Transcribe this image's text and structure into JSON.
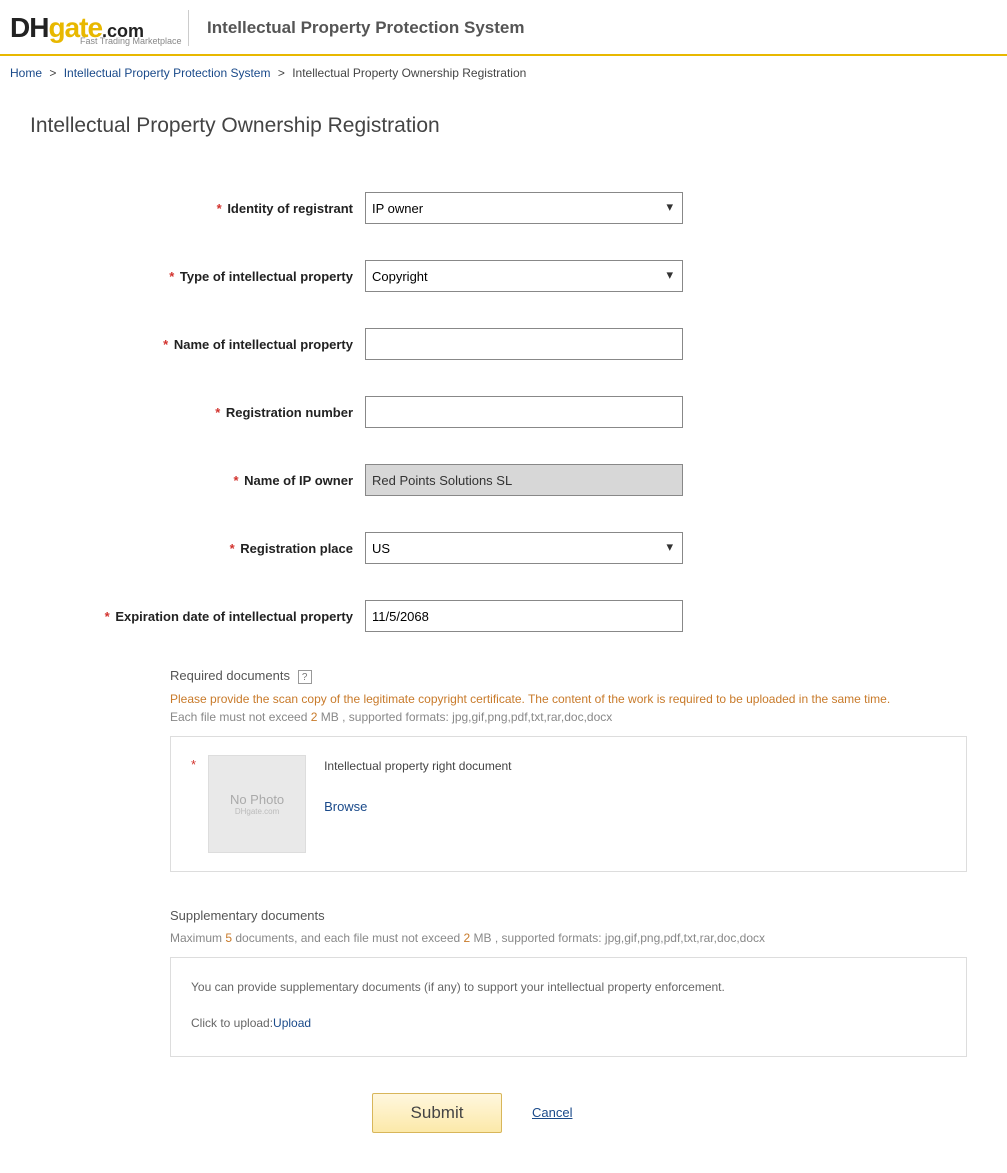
{
  "header": {
    "logo_dh": "DH",
    "logo_gate": "gate",
    "logo_com": ".com",
    "logo_tagline": "Fast Trading Marketplace",
    "title": "Intellectual Property Protection System"
  },
  "breadcrumb": {
    "home": "Home",
    "system": "Intellectual Property Protection System",
    "current": "Intellectual Property Ownership Registration"
  },
  "page_title": "Intellectual Property Ownership Registration",
  "form": {
    "identity_label": "Identity of registrant",
    "identity_value": "IP owner",
    "type_label": "Type of intellectual property",
    "type_value": "Copyright",
    "name_ip_label": "Name of intellectual property",
    "name_ip_value": "",
    "reg_num_label": "Registration number",
    "reg_num_value": "",
    "owner_label": "Name of IP owner",
    "owner_value": "Red Points Solutions SL",
    "place_label": "Registration place",
    "place_value": "US",
    "expire_label": "Expiration date of intellectual property",
    "expire_value": "11/5/2068"
  },
  "required_docs": {
    "heading": "Required documents",
    "notice": "Please provide the scan copy of the legitimate copyright certificate. The content of the work is required to be uploaded in the same time.",
    "sub_before": "Each file must not exceed ",
    "sub_hl": "2",
    "sub_after": " MB , supported formats: jpg,gif,png,pdf,txt,rar,doc,docx",
    "no_photo_text": "No Photo",
    "no_photo_sub": "DHgate.com",
    "doc_label": "Intellectual property right document",
    "browse": "Browse"
  },
  "supp": {
    "heading": "Supplementary documents",
    "sub_before": "Maximum ",
    "sub_hl1": "5",
    "sub_mid": " documents, and each file must not exceed ",
    "sub_hl2": "2",
    "sub_after": " MB , supported formats: jpg,gif,png,pdf,txt,rar,doc,docx",
    "line1": "You can provide supplementary documents (if any) to support your intellectual property enforcement.",
    "line2_prefix": "Click to upload:",
    "upload": "Upload"
  },
  "buttons": {
    "submit": "Submit",
    "cancel": "Cancel"
  }
}
